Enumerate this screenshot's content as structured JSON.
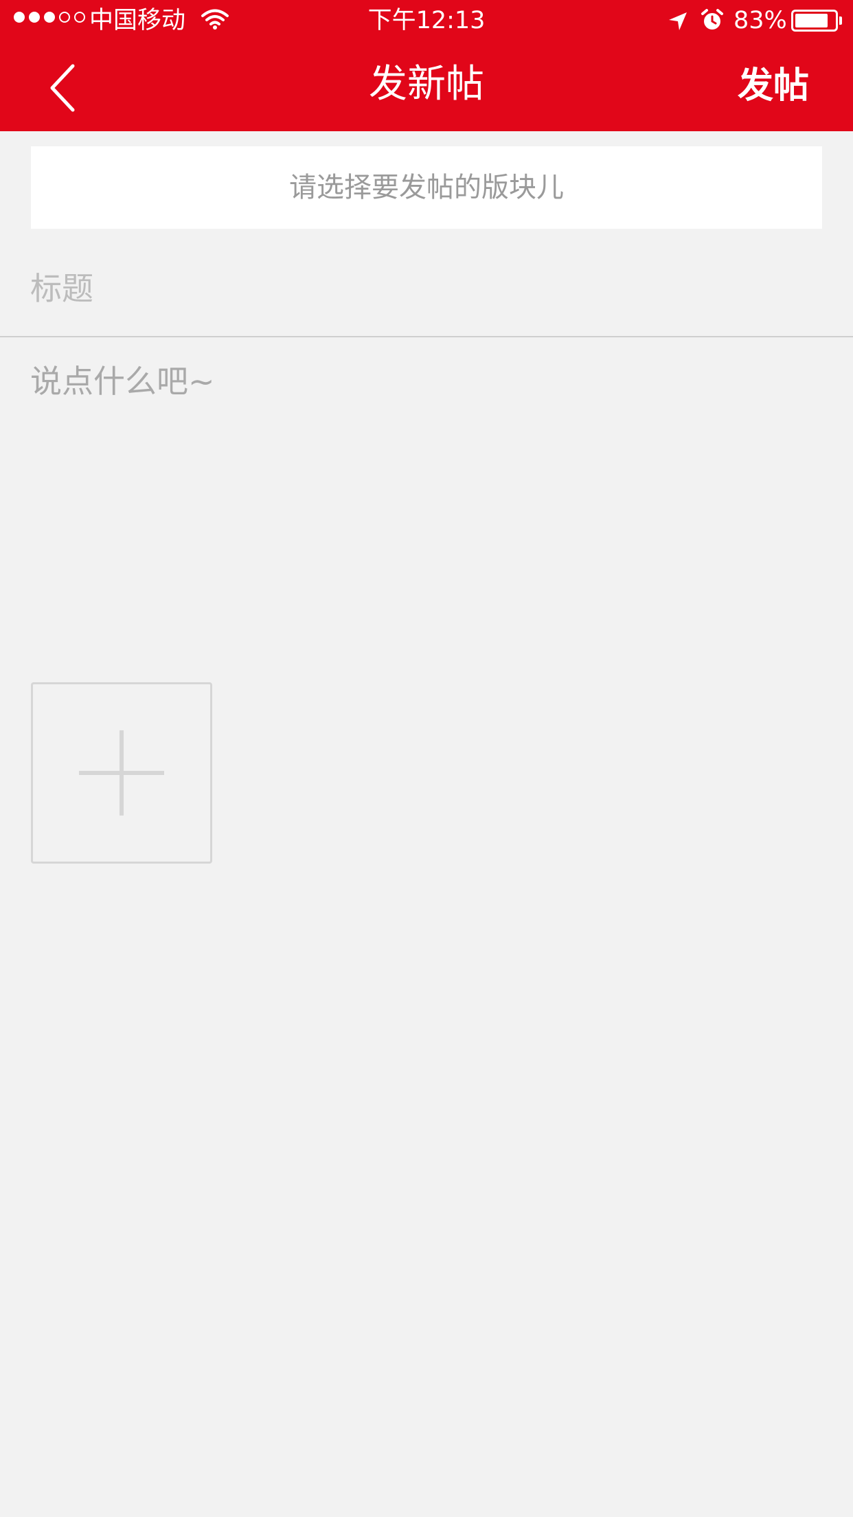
{
  "status_bar": {
    "signal": [
      "filled",
      "filled",
      "filled",
      "empty",
      "empty"
    ],
    "carrier": "中国移动",
    "time": "下午12:13",
    "battery_percent_text": "83%",
    "battery_level": 0.83,
    "icons": [
      "wifi-icon",
      "location-arrow-icon",
      "alarm-clock-icon",
      "battery-icon"
    ]
  },
  "nav": {
    "background_color": "#e10619",
    "back_icon": "chevron-left-icon",
    "title": "发新帖",
    "submit_label": "发帖"
  },
  "form": {
    "board_selector_label": "请选择要发帖的版块儿",
    "title_placeholder": "标题",
    "title_value": "",
    "content_placeholder": "说点什么吧~",
    "content_value": "",
    "add_image_icon": "plus-icon"
  }
}
